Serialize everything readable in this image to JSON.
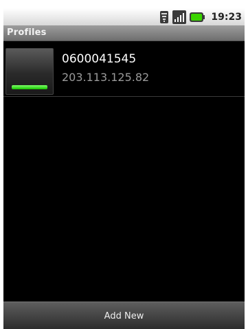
{
  "status_bar": {
    "time": "19:23",
    "icons": [
      "wifi-icon",
      "signal-icon",
      "battery-icon"
    ]
  },
  "title_bar": {
    "title": "Profiles"
  },
  "profiles": [
    {
      "name": "0600041545",
      "ip": "203.113.125.82",
      "status_color": "#18c400"
    }
  ],
  "bottom_bar": {
    "add_label": "Add New"
  },
  "colors": {
    "background": "#000000",
    "status_green": "#18c400",
    "secondary_text": "#9a9a9a"
  }
}
